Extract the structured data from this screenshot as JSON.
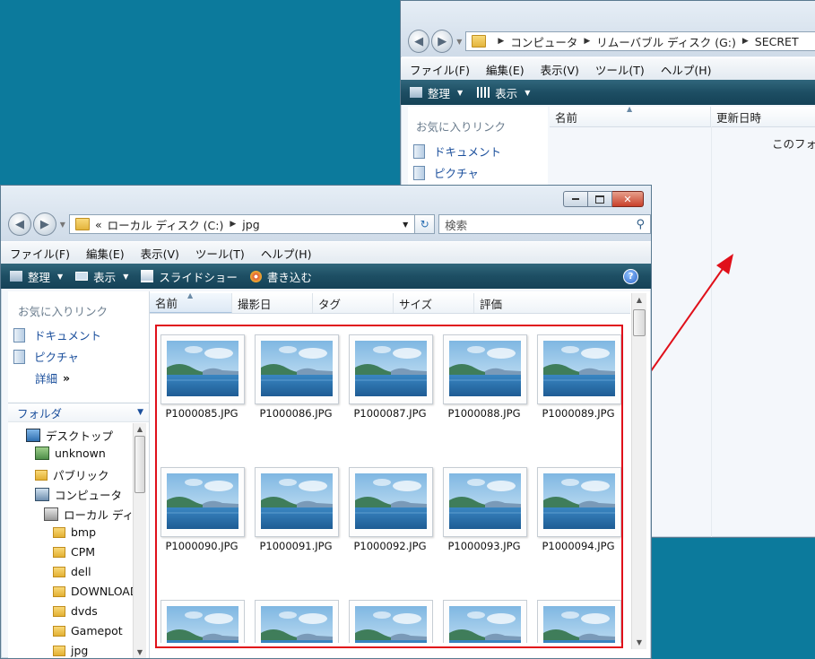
{
  "back_window": {
    "breadcrumb": [
      "コンピュータ",
      "リムーバブル ディスク (G:)",
      "SECRET"
    ],
    "menu": [
      "ファイル(F)",
      "編集(E)",
      "表示(V)",
      "ツール(T)",
      "ヘルプ(H)"
    ],
    "toolbar": {
      "organize": "整理",
      "view": "表示"
    },
    "favorites_title": "お気に入りリンク",
    "favorites": [
      "ドキュメント",
      "ピクチャ"
    ],
    "columns": [
      "名前",
      "更新日時"
    ],
    "empty_text": "このフォ"
  },
  "front_window": {
    "breadcrumb_prefix": "«",
    "breadcrumb": [
      "ローカル ディスク (C:)",
      "jpg"
    ],
    "search_placeholder": "検索",
    "menu": [
      "ファイル(F)",
      "編集(E)",
      "表示(V)",
      "ツール(T)",
      "ヘルプ(H)"
    ],
    "toolbar": {
      "organize": "整理",
      "view": "表示",
      "slideshow": "スライドショー",
      "burn": "書き込む"
    },
    "favorites_title": "お気に入りリンク",
    "favorites": [
      "ドキュメント",
      "ピクチャ"
    ],
    "details_link": "詳細",
    "folders_title": "フォルダ",
    "tree": [
      {
        "label": "デスクトップ",
        "icon": "desktop-icon"
      },
      {
        "label": "unknown",
        "icon": "user-icon"
      },
      {
        "label": "パブリック",
        "icon": "folder-icon"
      },
      {
        "label": "コンピュータ",
        "icon": "computer-icon"
      },
      {
        "label": "ローカル ディ",
        "icon": "drive-icon"
      },
      {
        "label": "bmp",
        "icon": "folder-icon"
      },
      {
        "label": "CPM",
        "icon": "folder-icon"
      },
      {
        "label": "dell",
        "icon": "folder-icon"
      },
      {
        "label": "DOWNLOAD",
        "icon": "folder-icon"
      },
      {
        "label": "dvds",
        "icon": "folder-icon"
      },
      {
        "label": "Gamepot",
        "icon": "folder-icon"
      },
      {
        "label": "jpg",
        "icon": "folder-icon"
      }
    ],
    "columns": [
      "名前",
      "撮影日",
      "タグ",
      "サイズ",
      "評価"
    ],
    "files": [
      "P1000085.JPG",
      "P1000086.JPG",
      "P1000087.JPG",
      "P1000088.JPG",
      "P1000089.JPG",
      "P1000090.JPG",
      "P1000091.JPG",
      "P1000092.JPG",
      "P1000093.JPG",
      "P1000094.JPG"
    ],
    "partial_row_count": 5
  },
  "colors": {
    "desktop": "#0c7a9c",
    "highlight": "#e0101a",
    "link": "#1b4f9c",
    "toolbar": "#1d4e63"
  }
}
